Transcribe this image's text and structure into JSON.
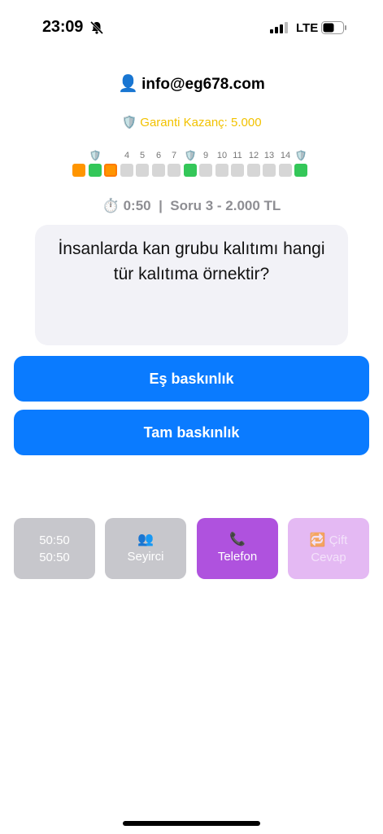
{
  "status": {
    "time": "23:09",
    "network": "LTE",
    "icons": [
      "bell-off-icon",
      "signal-icon",
      "battery-icon"
    ]
  },
  "header": {
    "user_icon": "person-icon",
    "email": "info@eg678.com",
    "guarantee_icon": "shield-icon",
    "guarantee_text": "Garanti Kazanç: 5.000"
  },
  "ladder": {
    "steps": [
      {
        "label": "",
        "state": "orange"
      },
      {
        "label": "shield",
        "state": "green"
      },
      {
        "label": "",
        "state": "orange-current"
      },
      {
        "label": "4",
        "state": "empty"
      },
      {
        "label": "5",
        "state": "empty"
      },
      {
        "label": "6",
        "state": "empty"
      },
      {
        "label": "7",
        "state": "empty"
      },
      {
        "label": "shield",
        "state": "green"
      },
      {
        "label": "9",
        "state": "empty"
      },
      {
        "label": "10",
        "state": "empty"
      },
      {
        "label": "11",
        "state": "empty"
      },
      {
        "label": "12",
        "state": "empty"
      },
      {
        "label": "13",
        "state": "empty"
      },
      {
        "label": "14",
        "state": "empty"
      },
      {
        "label": "shield",
        "state": "green"
      }
    ]
  },
  "timer": {
    "icon": "stopwatch-icon",
    "text": "0:50  |  Soru 3 - 2.000 TL"
  },
  "question": {
    "text": "İnsanlarda kan grubu kalıtımı hangi tür kalıtıma örnektir?"
  },
  "answers": [
    {
      "label": "Eş baskınlık"
    },
    {
      "label": "Tam baskınlık"
    }
  ],
  "jokers": {
    "fifty": {
      "line1": "50:50",
      "line2": "50:50"
    },
    "audience": {
      "icon": "audience-icon",
      "label": "Seyirci"
    },
    "phone": {
      "icon": "phone-icon",
      "label": "Telefon"
    },
    "double": {
      "icon": "repeat-icon",
      "label1": "Çift",
      "label2": "Cevap"
    }
  },
  "colors": {
    "primary": "#0a7bff",
    "orange": "#ff9500",
    "green": "#34c759",
    "purple": "#af52de",
    "guarantee": "#f2c200"
  }
}
